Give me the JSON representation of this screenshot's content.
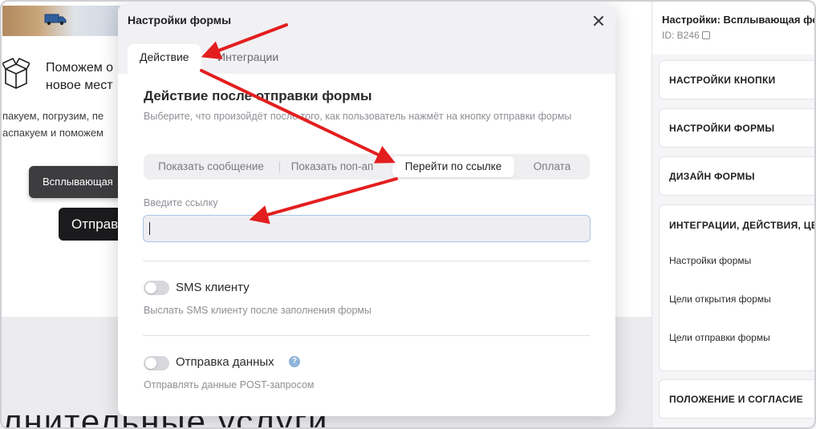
{
  "background": {
    "heading": "Поможем о\nновое мест",
    "text": "пакуем, погрузим, пе\nаспакуем и поможем",
    "popup_button": "Всплывающая",
    "send_button": "Отправ",
    "big_text": "лнительные услуги"
  },
  "right_panel": {
    "title": "Настройки: Всплывающая фо",
    "id": "ID: B246",
    "cards": [
      {
        "title": "НАСТРОЙКИ КНОПКИ"
      },
      {
        "title": "НАСТРОЙКИ ФОРМЫ"
      },
      {
        "title": "ДИЗАЙН ФОРМЫ"
      },
      {
        "title": "ИНТЕГРАЦИИ, ДЕЙСТВИЯ, ЦЕ",
        "items": [
          "Настройки формы",
          "Цели открытия формы",
          "Цели отправки формы"
        ]
      },
      {
        "title": "ПОЛОЖЕНИЕ И СОГЛАСИЕ"
      }
    ]
  },
  "modal": {
    "title": "Настройки формы",
    "tabs": [
      "Действие",
      "Интеграции"
    ],
    "section_title": "Действие после отправки формы",
    "section_desc": "Выберите, что произойдёт после того, как пользователь нажмёт на кнопку отправки формы",
    "segments": [
      "Показать сообщение",
      "Показать поп-ап",
      "Перейти по ссылке",
      "Оплата"
    ],
    "active_segment": "Перейти по ссылке",
    "link_label": "Введите ссылку",
    "link_value": "",
    "sms": {
      "label": "SMS клиенту",
      "desc": "Выслать SMS клиенту после заполнения формы",
      "enabled": false
    },
    "post": {
      "label": "Отправка данных",
      "desc": "Отправлять данные POST-запросом",
      "enabled": false
    },
    "help_glyph": "?"
  },
  "colors": {
    "arrow": "#e31e1e",
    "input_border": "#a9c6e6",
    "accent_help": "#8fb3d9"
  }
}
